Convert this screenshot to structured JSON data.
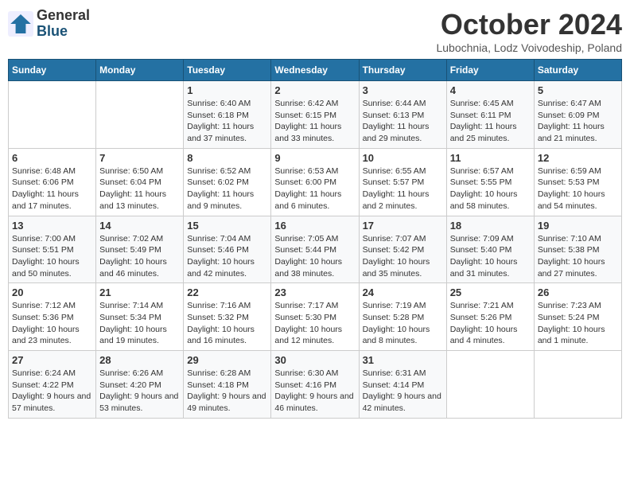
{
  "logo": {
    "line1": "General",
    "line2": "Blue"
  },
  "title": "October 2024",
  "subtitle": "Lubochnia, Lodz Voivodeship, Poland",
  "days_of_week": [
    "Sunday",
    "Monday",
    "Tuesday",
    "Wednesday",
    "Thursday",
    "Friday",
    "Saturday"
  ],
  "weeks": [
    [
      {
        "num": "",
        "info": ""
      },
      {
        "num": "",
        "info": ""
      },
      {
        "num": "1",
        "info": "Sunrise: 6:40 AM\nSunset: 6:18 PM\nDaylight: 11 hours and 37 minutes."
      },
      {
        "num": "2",
        "info": "Sunrise: 6:42 AM\nSunset: 6:15 PM\nDaylight: 11 hours and 33 minutes."
      },
      {
        "num": "3",
        "info": "Sunrise: 6:44 AM\nSunset: 6:13 PM\nDaylight: 11 hours and 29 minutes."
      },
      {
        "num": "4",
        "info": "Sunrise: 6:45 AM\nSunset: 6:11 PM\nDaylight: 11 hours and 25 minutes."
      },
      {
        "num": "5",
        "info": "Sunrise: 6:47 AM\nSunset: 6:09 PM\nDaylight: 11 hours and 21 minutes."
      }
    ],
    [
      {
        "num": "6",
        "info": "Sunrise: 6:48 AM\nSunset: 6:06 PM\nDaylight: 11 hours and 17 minutes."
      },
      {
        "num": "7",
        "info": "Sunrise: 6:50 AM\nSunset: 6:04 PM\nDaylight: 11 hours and 13 minutes."
      },
      {
        "num": "8",
        "info": "Sunrise: 6:52 AM\nSunset: 6:02 PM\nDaylight: 11 hours and 9 minutes."
      },
      {
        "num": "9",
        "info": "Sunrise: 6:53 AM\nSunset: 6:00 PM\nDaylight: 11 hours and 6 minutes."
      },
      {
        "num": "10",
        "info": "Sunrise: 6:55 AM\nSunset: 5:57 PM\nDaylight: 11 hours and 2 minutes."
      },
      {
        "num": "11",
        "info": "Sunrise: 6:57 AM\nSunset: 5:55 PM\nDaylight: 10 hours and 58 minutes."
      },
      {
        "num": "12",
        "info": "Sunrise: 6:59 AM\nSunset: 5:53 PM\nDaylight: 10 hours and 54 minutes."
      }
    ],
    [
      {
        "num": "13",
        "info": "Sunrise: 7:00 AM\nSunset: 5:51 PM\nDaylight: 10 hours and 50 minutes."
      },
      {
        "num": "14",
        "info": "Sunrise: 7:02 AM\nSunset: 5:49 PM\nDaylight: 10 hours and 46 minutes."
      },
      {
        "num": "15",
        "info": "Sunrise: 7:04 AM\nSunset: 5:46 PM\nDaylight: 10 hours and 42 minutes."
      },
      {
        "num": "16",
        "info": "Sunrise: 7:05 AM\nSunset: 5:44 PM\nDaylight: 10 hours and 38 minutes."
      },
      {
        "num": "17",
        "info": "Sunrise: 7:07 AM\nSunset: 5:42 PM\nDaylight: 10 hours and 35 minutes."
      },
      {
        "num": "18",
        "info": "Sunrise: 7:09 AM\nSunset: 5:40 PM\nDaylight: 10 hours and 31 minutes."
      },
      {
        "num": "19",
        "info": "Sunrise: 7:10 AM\nSunset: 5:38 PM\nDaylight: 10 hours and 27 minutes."
      }
    ],
    [
      {
        "num": "20",
        "info": "Sunrise: 7:12 AM\nSunset: 5:36 PM\nDaylight: 10 hours and 23 minutes."
      },
      {
        "num": "21",
        "info": "Sunrise: 7:14 AM\nSunset: 5:34 PM\nDaylight: 10 hours and 19 minutes."
      },
      {
        "num": "22",
        "info": "Sunrise: 7:16 AM\nSunset: 5:32 PM\nDaylight: 10 hours and 16 minutes."
      },
      {
        "num": "23",
        "info": "Sunrise: 7:17 AM\nSunset: 5:30 PM\nDaylight: 10 hours and 12 minutes."
      },
      {
        "num": "24",
        "info": "Sunrise: 7:19 AM\nSunset: 5:28 PM\nDaylight: 10 hours and 8 minutes."
      },
      {
        "num": "25",
        "info": "Sunrise: 7:21 AM\nSunset: 5:26 PM\nDaylight: 10 hours and 4 minutes."
      },
      {
        "num": "26",
        "info": "Sunrise: 7:23 AM\nSunset: 5:24 PM\nDaylight: 10 hours and 1 minute."
      }
    ],
    [
      {
        "num": "27",
        "info": "Sunrise: 6:24 AM\nSunset: 4:22 PM\nDaylight: 9 hours and 57 minutes."
      },
      {
        "num": "28",
        "info": "Sunrise: 6:26 AM\nSunset: 4:20 PM\nDaylight: 9 hours and 53 minutes."
      },
      {
        "num": "29",
        "info": "Sunrise: 6:28 AM\nSunset: 4:18 PM\nDaylight: 9 hours and 49 minutes."
      },
      {
        "num": "30",
        "info": "Sunrise: 6:30 AM\nSunset: 4:16 PM\nDaylight: 9 hours and 46 minutes."
      },
      {
        "num": "31",
        "info": "Sunrise: 6:31 AM\nSunset: 4:14 PM\nDaylight: 9 hours and 42 minutes."
      },
      {
        "num": "",
        "info": ""
      },
      {
        "num": "",
        "info": ""
      }
    ]
  ]
}
